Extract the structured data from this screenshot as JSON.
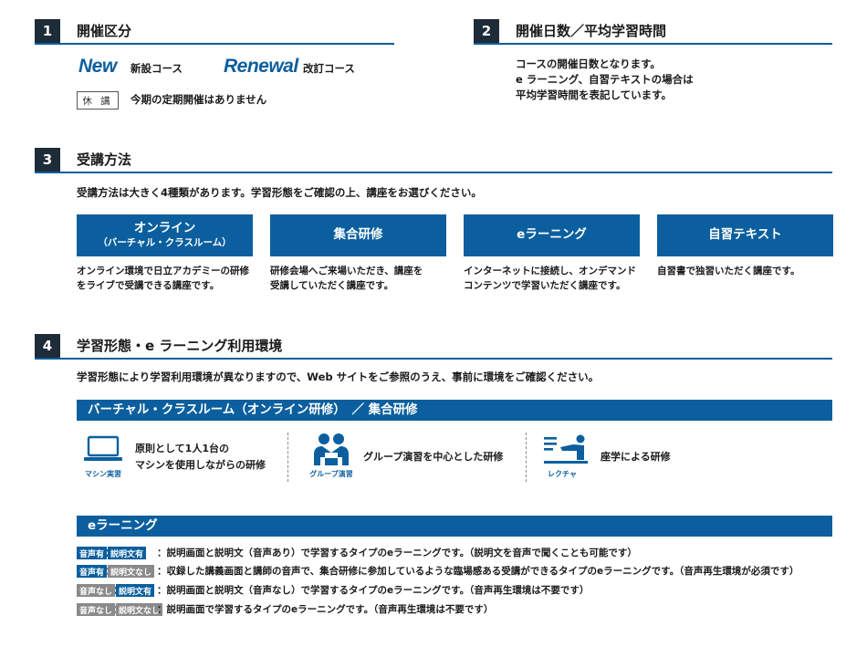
{
  "sections": {
    "s1": {
      "num": "1",
      "title": "開催区分"
    },
    "s2": {
      "num": "2",
      "title": "開催日数／平均学習時間"
    },
    "s3": {
      "num": "3",
      "title": "受講方法"
    },
    "s4": {
      "num": "4",
      "title": "学習形態・e ラーニング利用環境"
    }
  },
  "kaisai": {
    "new_logo": "New",
    "new_label": "新設コース",
    "renewal_logo": "Renewal",
    "renewal_label": "改訂コース",
    "kyuko_badge": "休 講",
    "kyuko_label": "今期の定期開催はありません"
  },
  "nissu": {
    "line1": "コースの開催日数となります。",
    "line2": "e ラーニング、自習テキストの場合は",
    "line3": "平均学習時間を表記しています。"
  },
  "jukou": {
    "intro": "受講方法は大きく4種類があります。学習形態をご確認の上、講座をお選びください。",
    "methods": [
      {
        "title": "オンライン",
        "sub": "（バーチャル・クラスルーム）",
        "desc1": "オンライン環境で日立アカデミーの研修",
        "desc2": "をライブで受講できる講座です。"
      },
      {
        "title": "集合研修",
        "sub": "",
        "desc1": "研修会場へご来場いただき、講座を",
        "desc2": "受講していただく講座です。"
      },
      {
        "title": "eラーニング",
        "sub": "",
        "desc1": "インターネットに接続し、オンデマンド",
        "desc2": "コンテンツで学習いただく講座です。"
      },
      {
        "title": "自習テキスト",
        "sub": "",
        "desc1": "自習書で独習いただく講座です。",
        "desc2": ""
      }
    ]
  },
  "keitai": {
    "intro": "学習形態により学習利用環境が異なりますので、Web サイトをご参照のうえ、事前に環境をご確認ください。",
    "band1": "バーチャル・クラスルーム（オンライン研修）　／ 集合研修",
    "env": [
      {
        "icon": "laptop-icon",
        "label": "マシン実習",
        "line1": "原則として1人1台の",
        "line2": "マシンを使用しながらの研修"
      },
      {
        "icon": "group-icon",
        "label": "グループ演習",
        "line1": "グループ演習を中心とした研修",
        "line2": ""
      },
      {
        "icon": "lecture-icon",
        "label": "レクチャ",
        "line1": "座学による研修",
        "line2": ""
      }
    ],
    "band2": "eラーニング",
    "elearning": [
      {
        "badge1": "音声有",
        "badge2": "説明文有",
        "text": "：説明画面と説明文（音声あり）で学習するタイプのeラーニングです。（説明文を音声で聞くことも可能です）"
      },
      {
        "badge1": "音声有",
        "badge2": "説明文なし",
        "text": "：収録した講義画面と講師の音声で、集合研修に参加しているような臨場感ある受講ができるタイプのeラーニングです。（音声再生環境が必須です）"
      },
      {
        "badge1": "音声なし",
        "badge2": "説明文有",
        "text": "：説明画面と説明文（音声なし）で学習するタイプのeラーニングです。（音声再生環境は不要です）"
      },
      {
        "badge1": "音声なし",
        "badge2": "説明文なし",
        "text": "：説明画面で学習するタイプのeラーニングです。（音声再生環境は不要です）"
      }
    ]
  },
  "colors": {
    "accent": "#0b5f9e",
    "dark": "#1e2b39",
    "gray_badge": "#8a8a8a"
  }
}
